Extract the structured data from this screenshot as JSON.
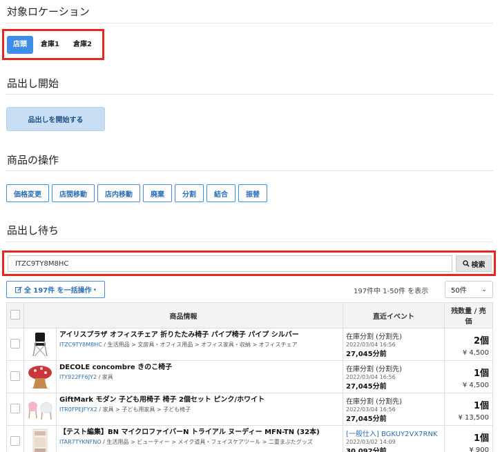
{
  "sections": {
    "location_title": "対象ロケーション",
    "picking_title": "品出し開始",
    "ops_title": "商品の操作",
    "waiting_title": "品出し待ち"
  },
  "locations": [
    {
      "label": "店頭",
      "active": true
    },
    {
      "label": "倉庫1",
      "active": false
    },
    {
      "label": "倉庫2",
      "active": false
    }
  ],
  "start_button": "品出しを開始する",
  "operations": [
    "価格変更",
    "店間移動",
    "店内移動",
    "廃棄",
    "分割",
    "結合",
    "振替"
  ],
  "search": {
    "value": "ITZC9TY8M8HC",
    "button": "検索"
  },
  "bulk_button": "全 197件 を一括操作",
  "count_text": "197件中 1-50件 を表示",
  "per_page": "50件",
  "table": {
    "headers": {
      "info": "商品情報",
      "event": "直近イベント",
      "stock": "残数量 / 売価"
    },
    "rows": [
      {
        "name": "アイリスプラザ オフィスチェア 折りたたみ椅子 パイプ椅子 パイプ シルバー",
        "code": "ITZC9TY8M8HC",
        "category": " / 生活用品 > 文房具・オフィス用品 > オフィス家具・収納 > オフィスチェア",
        "event": "在庫分割 (分割先)",
        "event_link": false,
        "date": "2022/03/04 16:56",
        "ago": "27,045分前",
        "qty": "2個",
        "price": "¥ 4,500",
        "thumb": "chair"
      },
      {
        "name": "DECOLE concombre きのこ椅子",
        "code": "ITY922FF6JY2",
        "category": " / 家具",
        "event": "在庫分割 (分割先)",
        "event_link": false,
        "date": "2022/03/04 16:56",
        "ago": "27,045分前",
        "qty": "1個",
        "price": "¥ 4,500",
        "thumb": "mushroom"
      },
      {
        "name": "GiftMark モダン 子ども用椅子 椅子 2個セット ピンク/ホワイト",
        "code": "ITR0FPEJFYX2",
        "category": " / 家具 > 子ども用家具 > 子ども椅子",
        "event": "在庫分割 (分割先)",
        "event_link": false,
        "date": "2022/03/04 16:56",
        "ago": "27,045分前",
        "qty": "1個",
        "price": "¥ 13,500",
        "thumb": "kidchairs"
      },
      {
        "name": "【テスト編集】BN マイクロファイバーN トライアル ヌーディー MFN-TN (32本)",
        "code": "ITAR7TYKNFNO",
        "category": " / 生活用品 > ビューティー > メイク道具・フェイスケアツール > 二重まぶたグッズ",
        "event": "[一般仕入] BGKUY2VX7RNK",
        "event_link": true,
        "date": "2022/03/02 14:09",
        "ago": "30,092分前",
        "qty": "1個",
        "price": "¥ 900",
        "thumb": "package"
      }
    ]
  }
}
